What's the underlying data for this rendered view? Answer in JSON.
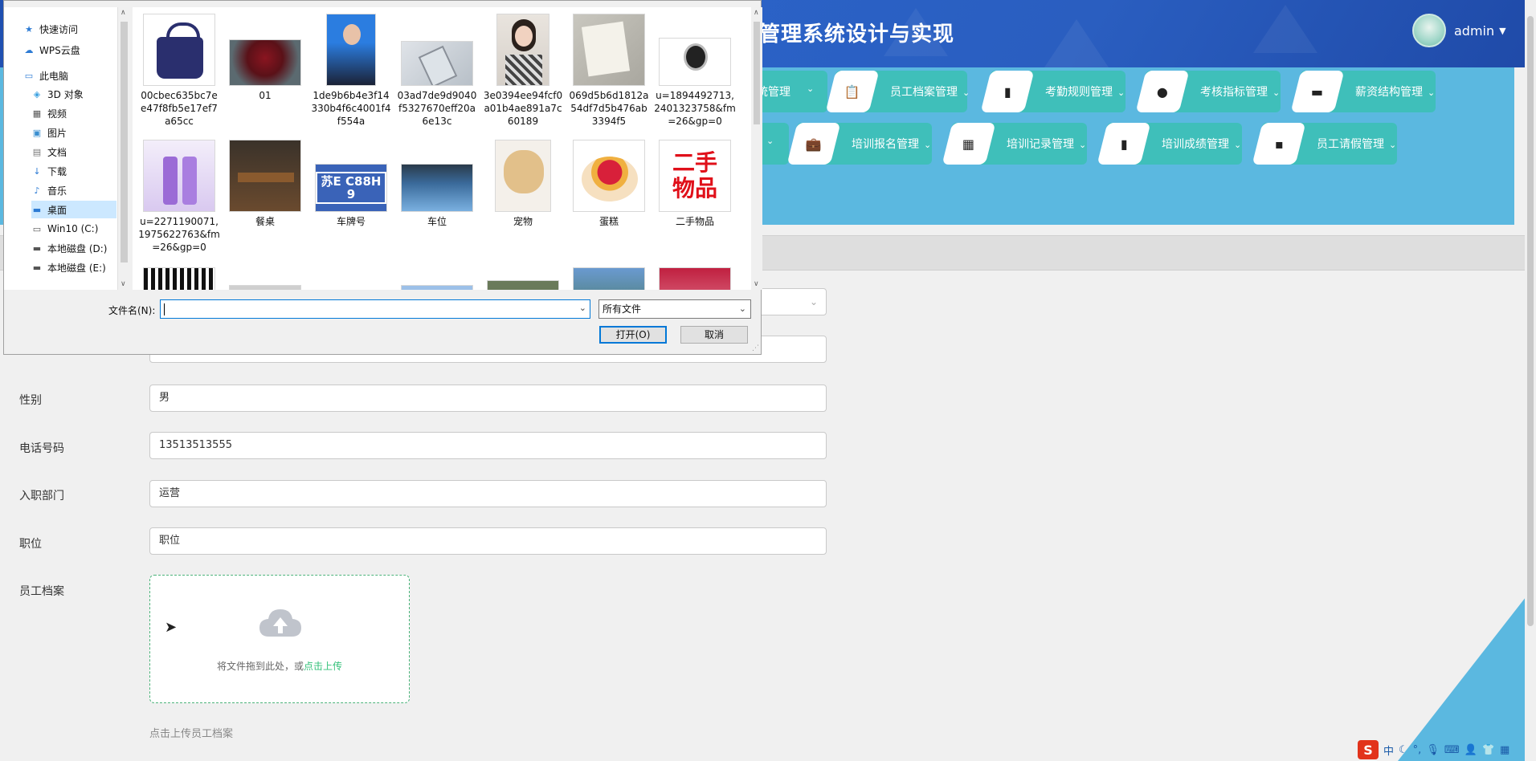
{
  "app": {
    "title": "管理系统设计与实现",
    "user": "admin"
  },
  "nav": {
    "row1": [
      {
        "label": "统管理",
        "icon": ""
      },
      {
        "label": "员工档案管理",
        "icon": "clipboard-icon"
      },
      {
        "label": "考勤规则管理",
        "icon": "book-icon"
      },
      {
        "label": "考核指标管理",
        "icon": "bulb-icon"
      },
      {
        "label": "薪资结构管理",
        "icon": "monitor-icon"
      }
    ],
    "row2": [
      {
        "label": "",
        "icon": ""
      },
      {
        "label": "培训报名管理",
        "icon": "briefcase-icon"
      },
      {
        "label": "培训记录管理",
        "icon": "grid-icon"
      },
      {
        "label": "培训成绩管理",
        "icon": "bar-chart-icon"
      },
      {
        "label": "员工请假管理",
        "icon": "chat-icon"
      }
    ]
  },
  "form": {
    "gender_label": "性别",
    "gender_value": "男",
    "phone_label": "电话号码",
    "phone_value": "13513513555",
    "dept_label": "入职部门",
    "dept_value": "运营",
    "position_label": "职位",
    "position_value": "职位",
    "archive_label": "员工档案",
    "upload_hint": "将文件拖到此处，或",
    "upload_link": "点击上传",
    "upload_tip": "点击上传员工档案"
  },
  "dialog": {
    "nav_items": [
      "快速访问",
      "WPS云盘",
      "此电脑",
      "3D 对象",
      "视频",
      "图片",
      "文档",
      "下载",
      "音乐",
      "桌面",
      "Win10 (C:)",
      "本地磁盘 (D:)",
      "本地磁盘 (E:)"
    ],
    "files_row1": [
      "00cbec635bc7ee47f8fb5e17ef7a65cc",
      "01",
      "1de9b6b4e3f14330b4f6c4001f4f554a",
      "03ad7de9d9040f5327670eff20a6e13c",
      "3e0394ee94fcf0a01b4ae891a7c60189",
      "069d5b6d1812a54df7d5b476ab3394f5",
      "u=1894492713,2401323758&fm=26&gp=0"
    ],
    "files_row2": [
      "u=2271190071,1975622763&fm=26&gp=0",
      "餐桌",
      "车牌号",
      "车位",
      "宠物",
      "蛋糕",
      "二手物品"
    ],
    "plate_text": "苏E C88H9",
    "secondhand_text": "二手物品",
    "filename_label": "文件名(N):",
    "filename_value": "",
    "filetype_value": "所有文件",
    "open_label": "打开(O)",
    "cancel_label": "取消"
  },
  "tray": {
    "ime": "中"
  }
}
